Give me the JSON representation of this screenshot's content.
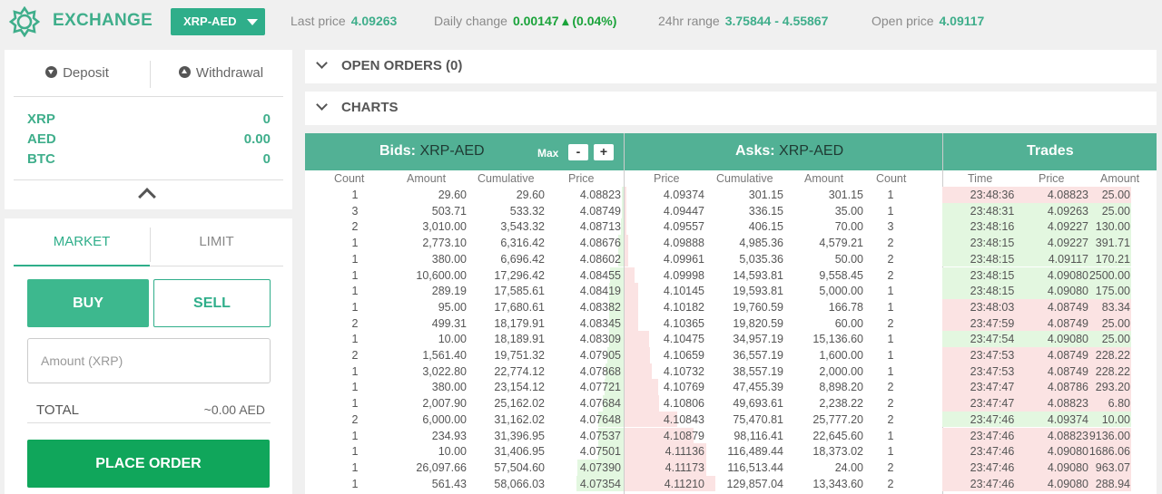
{
  "app": {
    "title": "EXCHANGE",
    "logo_icon": "gear-logo-icon"
  },
  "header": {
    "pair": "XRP-AED",
    "last_price_label": "Last price",
    "last_price": "4.09263",
    "daily_change_label": "Daily change",
    "daily_change": "0.00147 ▴ (0.04%)",
    "range_label": "24hr range",
    "range": "3.75844 - 4.55867",
    "open_price_label": "Open price",
    "open_price": "4.09117"
  },
  "wallet": {
    "deposit_label": "Deposit",
    "withdrawal_label": "Withdrawal",
    "balances": [
      {
        "currency": "XRP",
        "amount": "0"
      },
      {
        "currency": "AED",
        "amount": "0.00"
      },
      {
        "currency": "BTC",
        "amount": "0"
      }
    ]
  },
  "order_form": {
    "tab_market": "MARKET",
    "tab_limit": "LIMIT",
    "buy_label": "BUY",
    "sell_label": "SELL",
    "amount_placeholder": "Amount (XRP)",
    "total_label": "TOTAL",
    "total_value": "~0.00 AED",
    "place_order_label": "PLACE ORDER"
  },
  "sections": {
    "open_orders": "OPEN ORDERS (0)",
    "charts": "CHARTS"
  },
  "colors": {
    "accent": "#3fae8b",
    "header_green": "#52b195",
    "place_order": "#10a65b",
    "bid_bg": "#e3f7e0",
    "ask_bg": "#fbe3e3",
    "up": "#1aa33a"
  },
  "book": {
    "bids_title": "Bids:",
    "asks_title": "Asks:",
    "pair": "XRP-AED",
    "trades_title": "Trades",
    "max_label": "Max",
    "zoom_out": "-",
    "zoom_in": "+",
    "bid_columns": [
      "Count",
      "Amount",
      "Cumulative",
      "Price"
    ],
    "ask_columns": [
      "Price",
      "Cumulative",
      "Amount",
      "Count"
    ],
    "trade_columns": [
      "Time",
      "Price",
      "Amount"
    ],
    "bids": [
      [
        "1",
        "29.60",
        "29.60",
        "4.08823"
      ],
      [
        "3",
        "503.71",
        "533.32",
        "4.08749"
      ],
      [
        "2",
        "3,010.00",
        "3,543.32",
        "4.08713"
      ],
      [
        "1",
        "2,773.10",
        "6,316.42",
        "4.08676"
      ],
      [
        "1",
        "380.00",
        "6,696.42",
        "4.08602"
      ],
      [
        "1",
        "10,600.00",
        "17,296.42",
        "4.08455"
      ],
      [
        "1",
        "289.19",
        "17,585.61",
        "4.08419"
      ],
      [
        "1",
        "95.00",
        "17,680.61",
        "4.08382"
      ],
      [
        "2",
        "499.31",
        "18,179.91",
        "4.08345"
      ],
      [
        "1",
        "10.00",
        "18,189.91",
        "4.08309"
      ],
      [
        "2",
        "1,561.40",
        "19,751.32",
        "4.07905"
      ],
      [
        "1",
        "3,022.80",
        "22,774.12",
        "4.07868"
      ],
      [
        "1",
        "380.00",
        "23,154.12",
        "4.07721"
      ],
      [
        "1",
        "2,007.90",
        "25,162.02",
        "4.07684"
      ],
      [
        "2",
        "6,000.00",
        "31,162.02",
        "4.07648"
      ],
      [
        "1",
        "234.93",
        "31,396.95",
        "4.07537"
      ],
      [
        "1",
        "10.00",
        "31,406.95",
        "4.07501"
      ],
      [
        "1",
        "26,097.66",
        "57,504.60",
        "4.07390"
      ],
      [
        "1",
        "561.43",
        "58,066.03",
        "4.07354"
      ]
    ],
    "asks": [
      [
        "4.09374",
        "301.15",
        "301.15",
        "1"
      ],
      [
        "4.09447",
        "336.15",
        "35.00",
        "1"
      ],
      [
        "4.09557",
        "406.15",
        "70.00",
        "3"
      ],
      [
        "4.09888",
        "4,985.36",
        "4,579.21",
        "2"
      ],
      [
        "4.09961",
        "5,035.36",
        "50.00",
        "2"
      ],
      [
        "4.09998",
        "14,593.81",
        "9,558.45",
        "2"
      ],
      [
        "4.10145",
        "19,593.81",
        "5,000.00",
        "1"
      ],
      [
        "4.10182",
        "19,760.59",
        "166.78",
        "1"
      ],
      [
        "4.10365",
        "19,820.59",
        "60.00",
        "2"
      ],
      [
        "4.10475",
        "34,957.19",
        "15,136.60",
        "1"
      ],
      [
        "4.10659",
        "36,557.19",
        "1,600.00",
        "1"
      ],
      [
        "4.10732",
        "38,557.19",
        "2,000.00",
        "1"
      ],
      [
        "4.10769",
        "47,455.39",
        "8,898.20",
        "2"
      ],
      [
        "4.10806",
        "49,693.61",
        "2,238.22",
        "2"
      ],
      [
        "4.10843",
        "75,470.81",
        "25,777.20",
        "2"
      ],
      [
        "4.10879",
        "98,116.41",
        "22,645.60",
        "1"
      ],
      [
        "4.11136",
        "116,489.44",
        "18,373.02",
        "1"
      ],
      [
        "4.11173",
        "116,513.44",
        "24.00",
        "2"
      ],
      [
        "4.11210",
        "129,857.04",
        "13,343.60",
        "2"
      ]
    ],
    "trades": [
      [
        "23:48:36",
        "4.08823",
        "25.00",
        "sell"
      ],
      [
        "23:48:31",
        "4.09263",
        "25.00",
        "buy"
      ],
      [
        "23:48:16",
        "4.09227",
        "130.00",
        "buy"
      ],
      [
        "23:48:15",
        "4.09227",
        "391.71",
        "buy"
      ],
      [
        "23:48:15",
        "4.09117",
        "170.21",
        "buy"
      ],
      [
        "23:48:15",
        "4.09080",
        "2500.00",
        "buy"
      ],
      [
        "23:48:15",
        "4.09080",
        "175.00",
        "buy"
      ],
      [
        "23:48:03",
        "4.08749",
        "83.34",
        "sell"
      ],
      [
        "23:47:59",
        "4.08749",
        "25.00",
        "sell"
      ],
      [
        "23:47:54",
        "4.09080",
        "25.00",
        "buy"
      ],
      [
        "23:47:53",
        "4.08749",
        "228.22",
        "sell"
      ],
      [
        "23:47:53",
        "4.08749",
        "228.22",
        "sell"
      ],
      [
        "23:47:47",
        "4.08786",
        "293.20",
        "sell"
      ],
      [
        "23:47:47",
        "4.08823",
        "6.80",
        "sell"
      ],
      [
        "23:47:46",
        "4.09374",
        "10.00",
        "buy"
      ],
      [
        "23:47:46",
        "4.08823",
        "9136.00",
        "sell"
      ],
      [
        "23:47:46",
        "4.09080",
        "1686.06",
        "sell"
      ],
      [
        "23:47:46",
        "4.09080",
        "963.07",
        "sell"
      ],
      [
        "23:47:46",
        "4.09080",
        "288.94",
        "sell"
      ]
    ]
  }
}
